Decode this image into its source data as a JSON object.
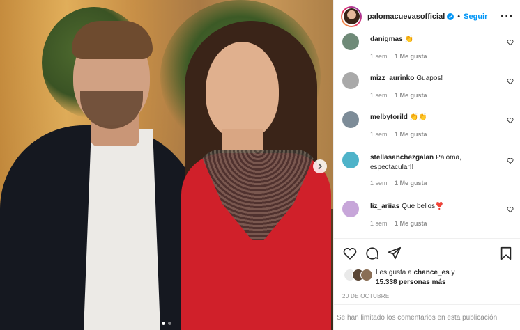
{
  "post": {
    "photo_alt": "photo",
    "carousel_total": 2,
    "carousel_index": 1
  },
  "header": {
    "username": "palomacuevasofficial",
    "separator": "•",
    "follow_label": "Seguir",
    "more_label": "···"
  },
  "comments": [
    {
      "user": "danigmas",
      "text": "👏",
      "time": "1 sem",
      "likes": "1 Me gusta",
      "avatar_color": "#6f8a78"
    },
    {
      "user": "mizz_aurinko",
      "text": "Guapos!",
      "time": "1 sem",
      "likes": "1 Me gusta",
      "avatar_color": "#a9a9a9"
    },
    {
      "user": "melbytorild",
      "text": "👏👏",
      "time": "1 sem",
      "likes": "1 Me gusta",
      "avatar_color": "#7d8c98"
    },
    {
      "user": "stellasanchezgalan",
      "text": "Paloma, espectacular!!",
      "time": "1 sem",
      "likes": "1 Me gusta",
      "avatar_color": "#4fb3c9"
    },
    {
      "user": "liz_ariias",
      "text": "Que bellos❣️",
      "time": "1 sem",
      "likes": "1 Me gusta",
      "avatar_color": "#c7a6d9"
    }
  ],
  "likes": {
    "prefix": "Les gusta a",
    "user": "chance_es",
    "middle": "y",
    "count_text": "15.338 personas más"
  },
  "date": "20 DE OCTUBRE",
  "footer": "Se han limitado los comentarios en esta publicación.",
  "colors": {
    "accent": "#0095f6",
    "text": "#262626",
    "muted": "#8e8e8e",
    "border": "#efefef"
  }
}
